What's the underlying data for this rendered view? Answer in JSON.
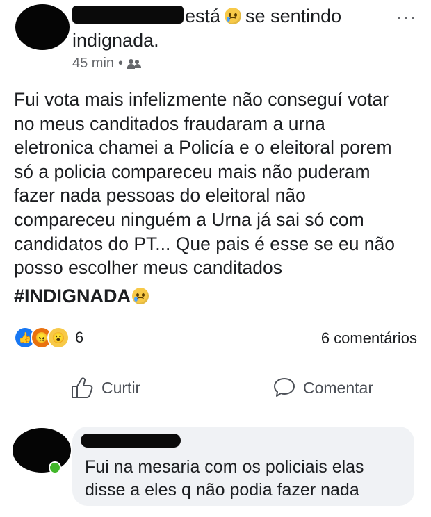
{
  "post": {
    "feeling_verb": "está",
    "feeling_phrase": "se sentindo",
    "feeling_word": "indignada.",
    "more_label": "···",
    "time": "45 min",
    "privacy_separator": "•",
    "privacy_icon": "friends-icon",
    "body": "Fui vota mais infelizmente não conseguí votar\nno meus canditados fraudaram a urna\neletronica chamei a Policía e o eleitoral porem\nsó a policia compareceu mais não puderam\nfazer nada pessoas do eleitoral não\ncompareceu ninguém a Urna já sai só com\ncandidatos do PT... Que pais é esse se eu não\nposso escolher meus canditados",
    "hashtag": "#INDIGNADA",
    "feeling_emoji": "sad-face-emoji"
  },
  "stats": {
    "reaction_icons": [
      "like-icon",
      "angry-icon",
      "wow-icon"
    ],
    "reaction_count": "6",
    "comment_count": "6 comentários"
  },
  "actions": {
    "like_label": "Curtir",
    "comment_label": "Comentar"
  },
  "comment": {
    "text": "Fui na mesaria com os policiais elas\ndisse a eles q não podia fazer nada"
  },
  "colors": {
    "like_blue": "#1877f2",
    "angry_orange": "#e9710f",
    "wow_yellow": "#f7c948",
    "online_green": "#42b72a",
    "bubble_bg": "#f0f2f5"
  }
}
